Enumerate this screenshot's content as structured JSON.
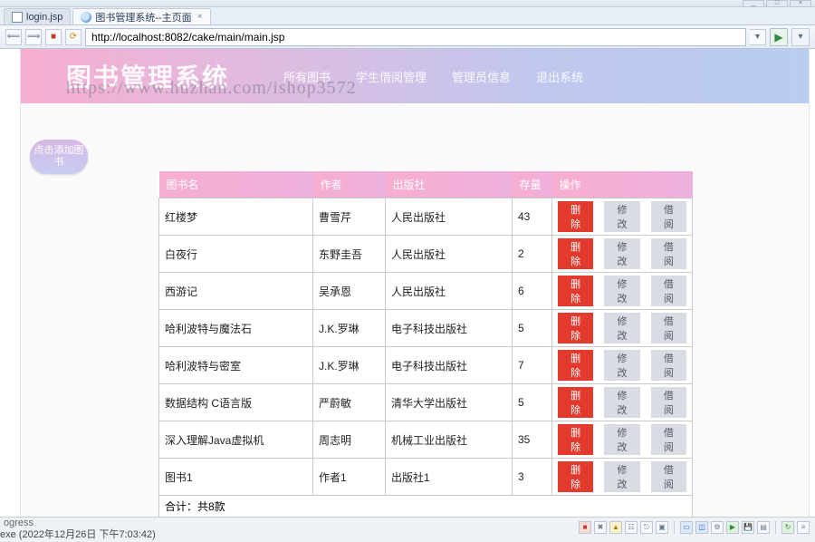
{
  "window": {
    "min_tip": "_",
    "max_tip": "□",
    "close_tip": "×"
  },
  "tabs": [
    {
      "label": "login.jsp"
    },
    {
      "label": "图书管理系统--主页面"
    }
  ],
  "address_bar": {
    "url": "http://localhost:8082/cake/main/main.jsp"
  },
  "hero": {
    "title": "图书管理系统",
    "watermark": "https://www.huzhan.com/ishop3572",
    "nav": {
      "all_books": "所有图书",
      "borrow_mgmt": "学生借阅管理",
      "admin_info": "管理员信息",
      "logout": "退出系统"
    }
  },
  "add_bubble": "点击添加图书",
  "table": {
    "headers": {
      "name": "图书名",
      "author": "作者",
      "publisher": "出版社",
      "stock": "存量",
      "ops": "操作"
    },
    "buttons": {
      "del": "删除",
      "edit": "修改",
      "borrow": "借阅"
    },
    "rows": [
      {
        "name": "红楼梦",
        "author": "曹雪芹",
        "publisher": "人民出版社",
        "stock": "43"
      },
      {
        "name": "白夜行",
        "author": "东野圭吾",
        "publisher": "人民出版社",
        "stock": "2"
      },
      {
        "name": "西游记",
        "author": "吴承恩",
        "publisher": "人民出版社",
        "stock": "6"
      },
      {
        "name": "哈利波特与魔法石",
        "author": "J.K.罗琳",
        "publisher": "电子科技出版社",
        "stock": "5"
      },
      {
        "name": "哈利波特与密室",
        "author": "J.K.罗琳",
        "publisher": "电子科技出版社",
        "stock": "7"
      },
      {
        "name": "数据结构 C语言版",
        "author": "严蔚敏",
        "publisher": "清华大学出版社",
        "stock": "5"
      },
      {
        "name": "深入理解Java虚拟机",
        "author": "周志明",
        "publisher": "机械工业出版社",
        "stock": "35"
      },
      {
        "name": "图书1",
        "author": "作者1",
        "publisher": "出版社1",
        "stock": "3"
      }
    ],
    "footer": "合计：共8款"
  },
  "bottom": {
    "panel": "ogress",
    "timestamp": "exe (2022年12月26日 下午7:03:42)"
  }
}
